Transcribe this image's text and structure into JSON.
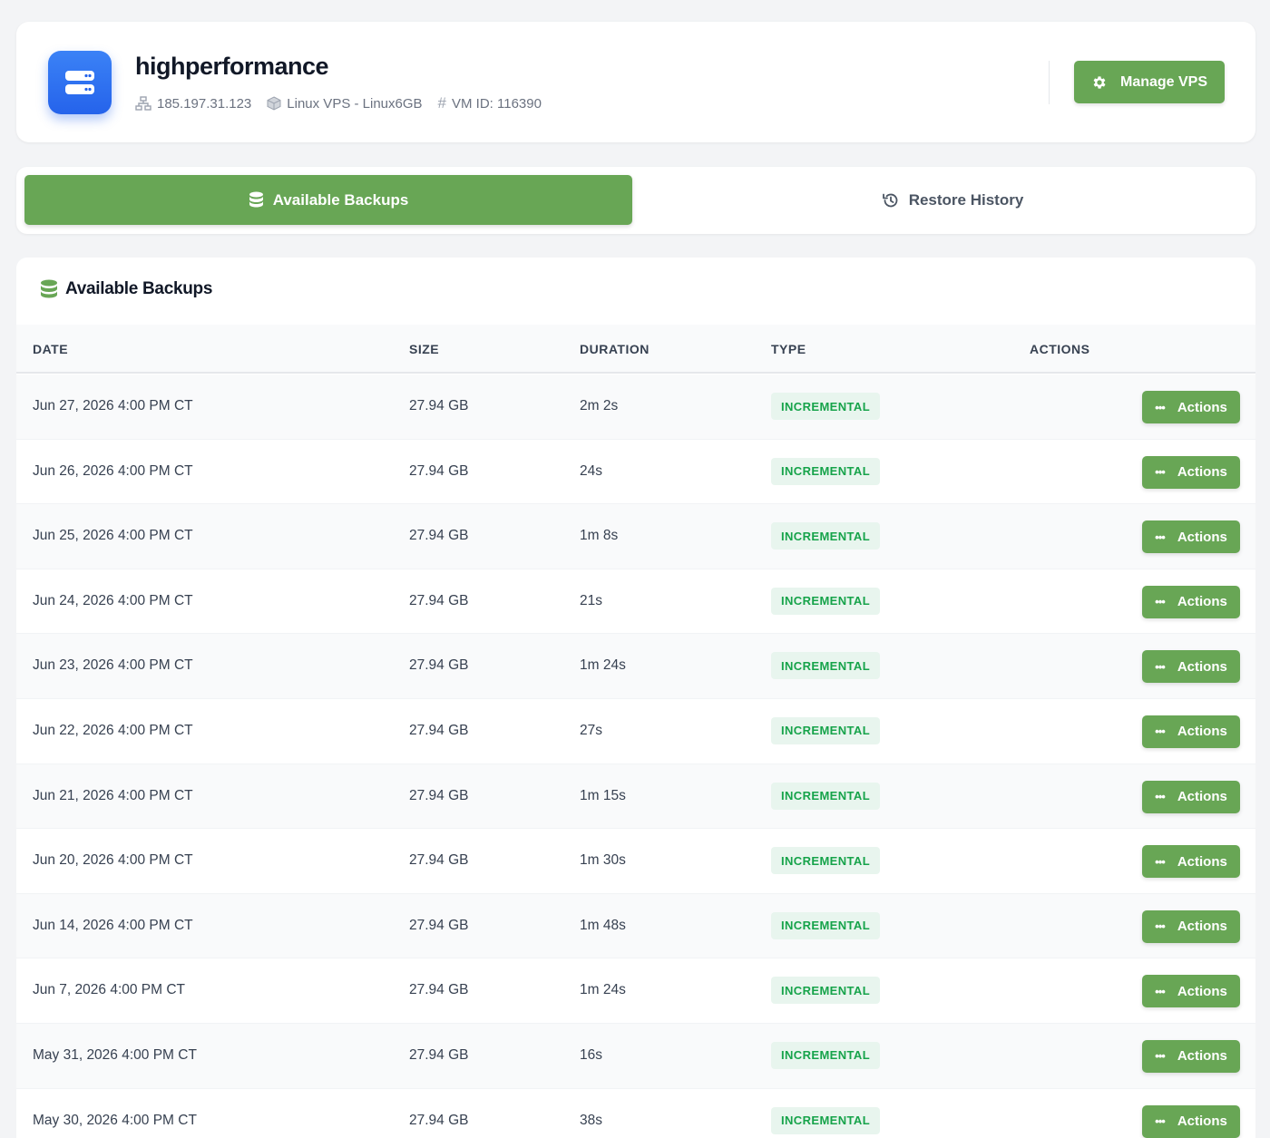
{
  "header": {
    "title": "highperformance",
    "ip": "185.197.31.123",
    "plan": "Linux VPS - Linux6GB",
    "vm_id": "VM ID: 116390",
    "manage_label": "Manage VPS"
  },
  "tabs": [
    {
      "label": "Available Backups",
      "active": true,
      "icon": "database-icon"
    },
    {
      "label": "Restore History",
      "active": false,
      "icon": "history-icon"
    }
  ],
  "panel": {
    "title": "Available Backups",
    "columns": [
      "DATE",
      "SIZE",
      "DURATION",
      "TYPE",
      "ACTIONS"
    ]
  },
  "backups": [
    {
      "date": "Jun 27, 2026 4:00 PM CT",
      "size": "27.94 GB",
      "duration": "2m 2s",
      "type": "INCREMENTAL",
      "action": "Actions"
    },
    {
      "date": "Jun 26, 2026 4:00 PM CT",
      "size": "27.94 GB",
      "duration": "24s",
      "type": "INCREMENTAL",
      "action": "Actions"
    },
    {
      "date": "Jun 25, 2026 4:00 PM CT",
      "size": "27.94 GB",
      "duration": "1m 8s",
      "type": "INCREMENTAL",
      "action": "Actions"
    },
    {
      "date": "Jun 24, 2026 4:00 PM CT",
      "size": "27.94 GB",
      "duration": "21s",
      "type": "INCREMENTAL",
      "action": "Actions"
    },
    {
      "date": "Jun 23, 2026 4:00 PM CT",
      "size": "27.94 GB",
      "duration": "1m 24s",
      "type": "INCREMENTAL",
      "action": "Actions"
    },
    {
      "date": "Jun 22, 2026 4:00 PM CT",
      "size": "27.94 GB",
      "duration": "27s",
      "type": "INCREMENTAL",
      "action": "Actions"
    },
    {
      "date": "Jun 21, 2026 4:00 PM CT",
      "size": "27.94 GB",
      "duration": "1m 15s",
      "type": "INCREMENTAL",
      "action": "Actions"
    },
    {
      "date": "Jun 20, 2026 4:00 PM CT",
      "size": "27.94 GB",
      "duration": "1m 30s",
      "type": "INCREMENTAL",
      "action": "Actions"
    },
    {
      "date": "Jun 14, 2026 4:00 PM CT",
      "size": "27.94 GB",
      "duration": "1m 48s",
      "type": "INCREMENTAL",
      "action": "Actions"
    },
    {
      "date": "Jun 7, 2026 4:00 PM CT",
      "size": "27.94 GB",
      "duration": "1m 24s",
      "type": "INCREMENTAL",
      "action": "Actions"
    },
    {
      "date": "May 31, 2026 4:00 PM CT",
      "size": "27.94 GB",
      "duration": "16s",
      "type": "INCREMENTAL",
      "action": "Actions"
    },
    {
      "date": "May 30, 2026 4:00 PM CT",
      "size": "27.94 GB",
      "duration": "38s",
      "type": "INCREMENTAL",
      "action": "Actions"
    }
  ],
  "colors": {
    "accent": "#68a655",
    "logo": "#2563eb",
    "badge_bg": "#e8f5ee",
    "badge_text": "#16a34a"
  }
}
